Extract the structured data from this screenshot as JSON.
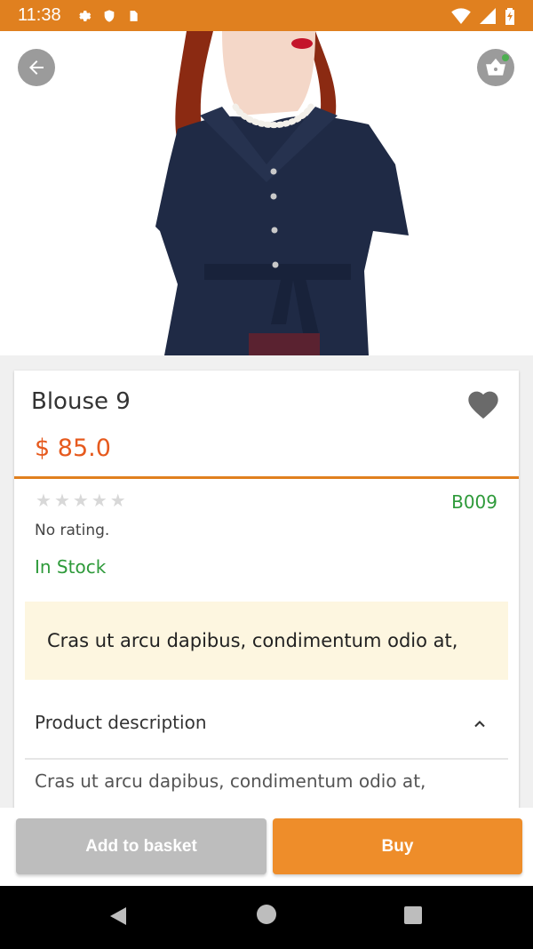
{
  "status_bar": {
    "time": "11:38",
    "icons": [
      "gear-icon",
      "shield-icon",
      "sdcard-icon",
      "wifi-icon",
      "signal-icon",
      "battery-charging-icon"
    ]
  },
  "hero": {
    "image_alt": "product-photo",
    "back_icon": "arrow-left-icon",
    "basket_icon": "basket-icon"
  },
  "product": {
    "name": "Blouse 9",
    "price": "$ 85.0",
    "sku": "B009",
    "rating_text": "No rating.",
    "stars": 5,
    "stock": "In Stock",
    "banner_text": "Cras ut arcu dapibus, condimentum odio at,",
    "description_header": "Product description",
    "description": "Cras ut arcu dapibus, condimentum odio at,"
  },
  "actions": {
    "add_label": "Add to basket",
    "buy_label": "Buy"
  },
  "colors": {
    "accent": "#e0801f",
    "price": "#e65a1e",
    "in_stock": "#2e9a3a",
    "banner": "#fdf6e0"
  }
}
